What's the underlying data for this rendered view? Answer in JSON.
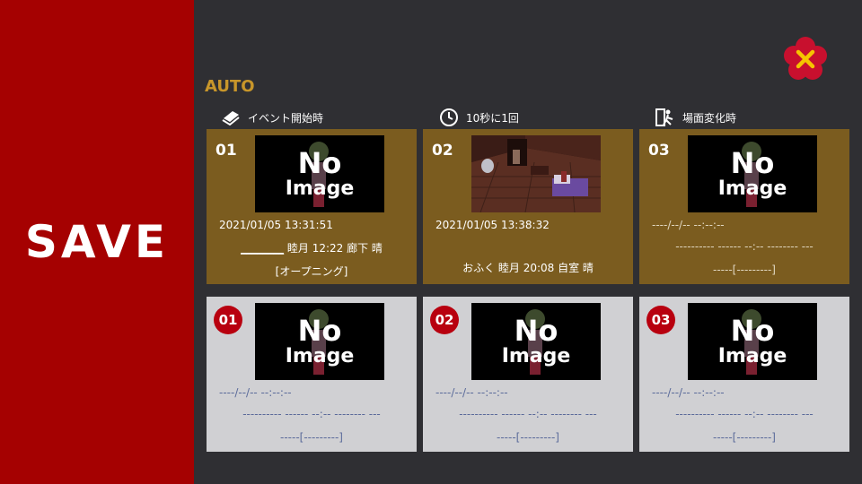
{
  "screen_title": "SAVE",
  "section_label": "AUTO",
  "columns": [
    {
      "icon": "book-icon",
      "label": "イベント開始時"
    },
    {
      "icon": "clock-icon",
      "label": "10秒に1回"
    },
    {
      "icon": "exit-door-icon",
      "label": "場面変化時"
    }
  ],
  "auto_slots": [
    {
      "num": "01",
      "has_image": false,
      "date": "2021/01/05  13:31:51",
      "line2_blank": "________",
      "line2": " 睦月  12:22  廊下  晴",
      "line3": "[オープニング]"
    },
    {
      "num": "02",
      "has_image": true,
      "date": "2021/01/05  13:38:32",
      "line2": "おふく  睦月  20:08  自室  晴",
      "line3": ""
    },
    {
      "num": "03",
      "has_image": false,
      "date": "----/--/--  --:--:--",
      "line2": "----------  ------  --:--  --------  ---",
      "line3": "-----[---------]"
    }
  ],
  "manual_slots": [
    {
      "num": "01",
      "date": "----/--/--  --:--:--",
      "line2": "----------  ------  --:--  --------  ---",
      "line3": "-----[---------]"
    },
    {
      "num": "02",
      "date": "----/--/--  --:--:--",
      "line2": "----------  ------  --:--  --------  ---",
      "line3": "-----[---------]"
    },
    {
      "num": "03",
      "date": "----/--/--  --:--:--",
      "line2": "----------  ------  --:--  --------  ---",
      "line3": "-----[---------]"
    }
  ],
  "no_image": {
    "line1": "No",
    "line2": "Image"
  },
  "colors": {
    "left_panel": "#a50101",
    "auto_slot": "#7b5c1f",
    "manual_slot": "#d0d0d3",
    "accent": "#c8962a",
    "badge": "#b8000f"
  }
}
